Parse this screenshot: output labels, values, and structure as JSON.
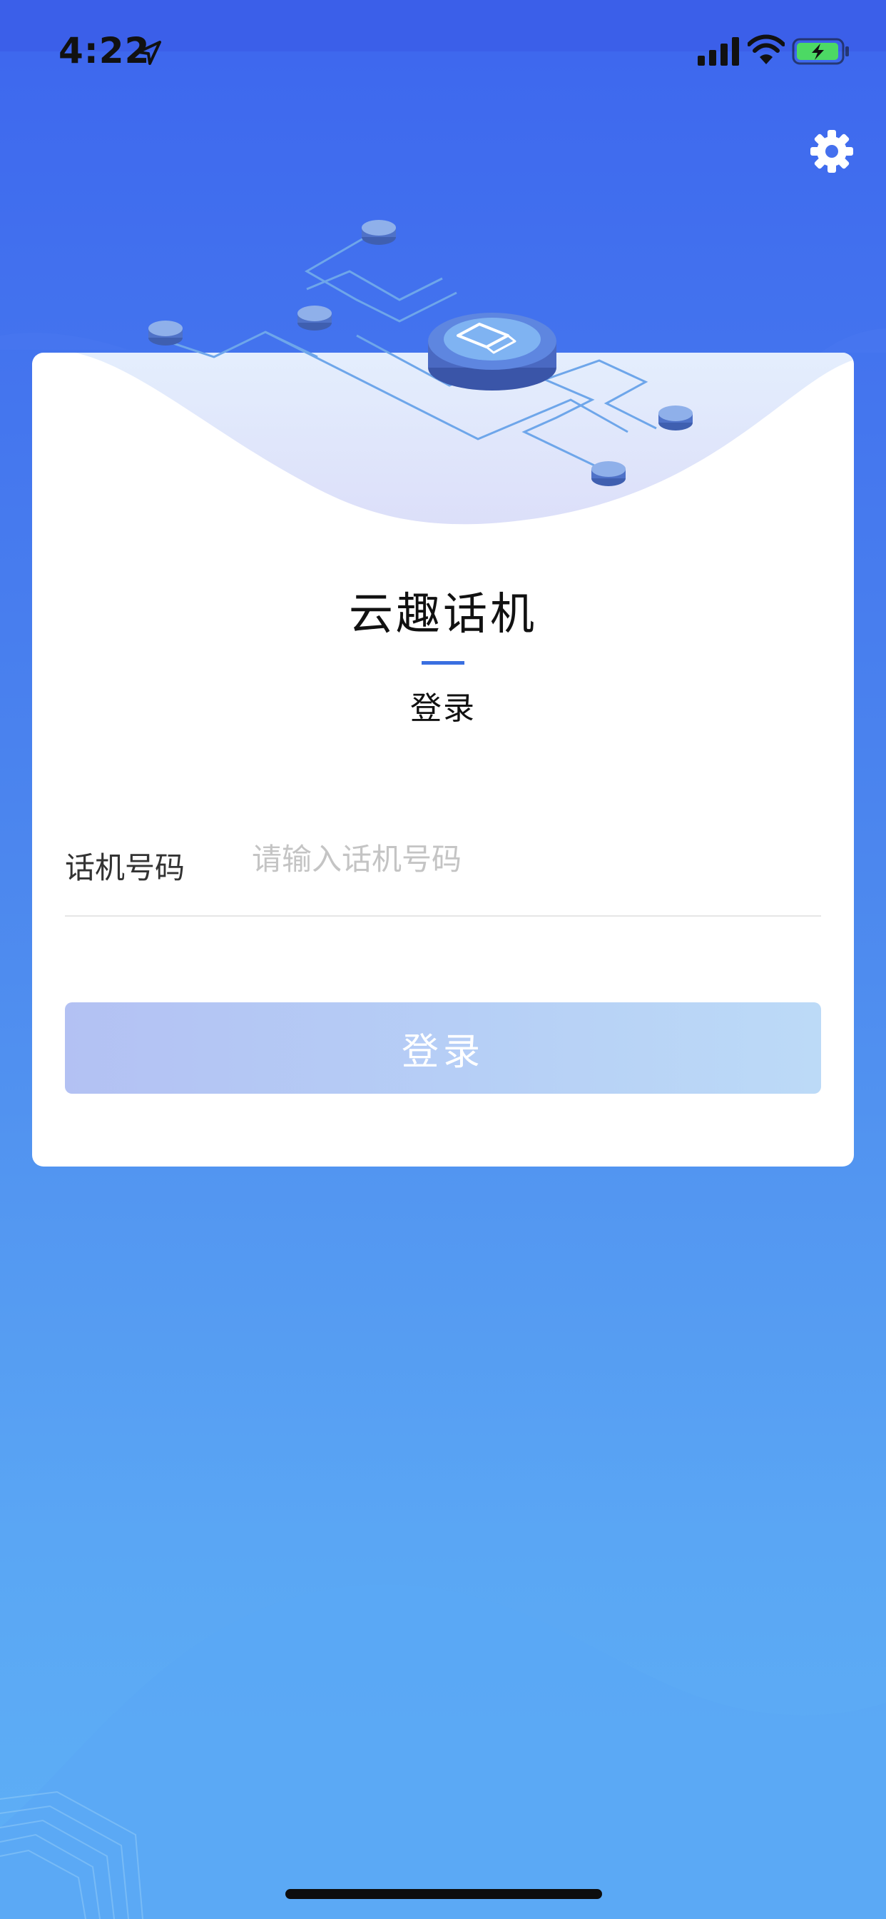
{
  "status_bar": {
    "time": "4:22"
  },
  "login_card": {
    "app_title": "云趣话机",
    "subtitle": "登录",
    "phone_field": {
      "label": "话机号码",
      "placeholder": "请输入话机号码",
      "value": ""
    },
    "login_button_label": "登录"
  },
  "icons": {
    "settings": "gear-icon",
    "location": "location-arrow-icon",
    "signal": "cellular-signal-icon",
    "wifi": "wifi-icon",
    "battery": "battery-charging-icon"
  },
  "colors": {
    "background_top": "#3d66ee",
    "background_bottom": "#5eb0f6",
    "accent": "#3a6fe0",
    "button_start": "#b3c1f3",
    "button_end": "#bcdaf7",
    "battery_fill": "#4cd964"
  }
}
